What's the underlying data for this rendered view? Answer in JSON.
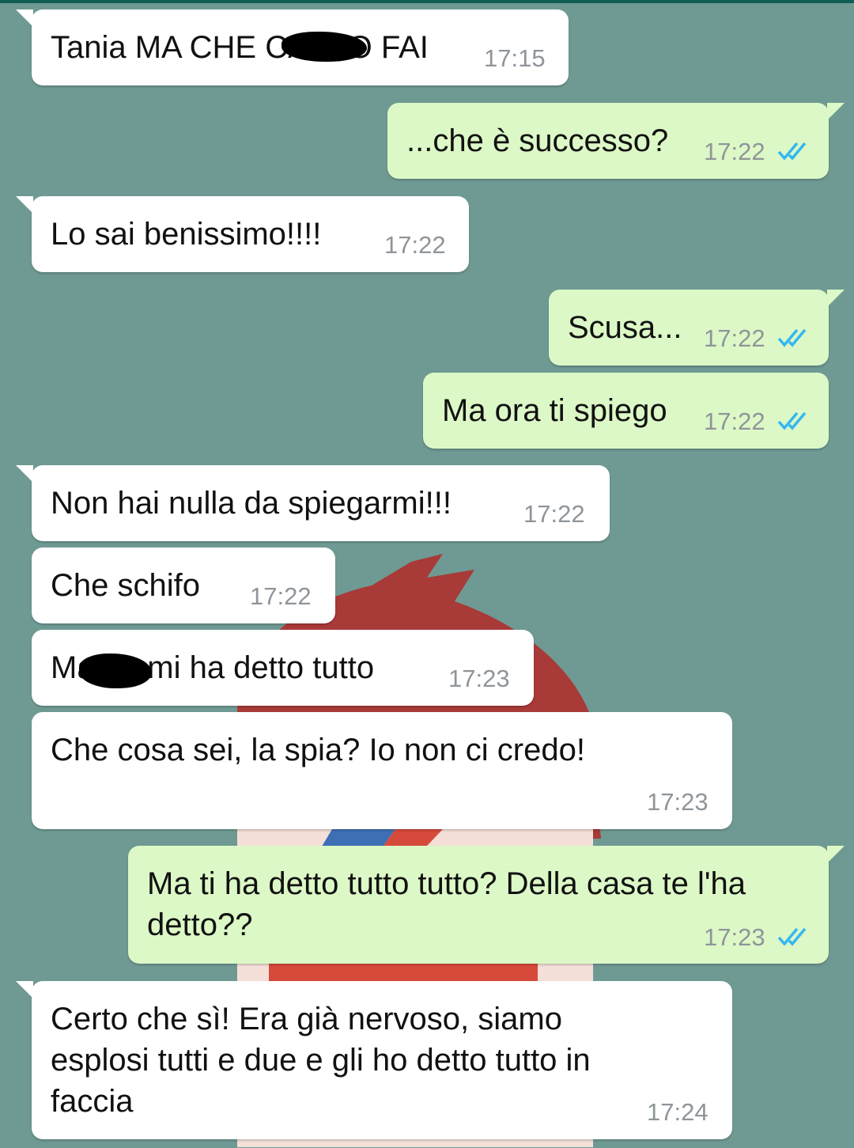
{
  "colors": {
    "background": "#6f9a93",
    "incoming_bubble": "#ffffff",
    "outgoing_bubble": "#dcf8c6",
    "read_ticks": "#34b7f1",
    "timestamp": "#8f959a"
  },
  "messages": [
    {
      "direction": "incoming",
      "text": "Tania MA CHE CAZZO FAI",
      "time": "17:15"
    },
    {
      "direction": "outgoing",
      "text": "...che è successo?",
      "time": "17:22",
      "status": "read"
    },
    {
      "direction": "incoming",
      "text": "Lo sai benissimo!!!!",
      "time": "17:22"
    },
    {
      "direction": "outgoing",
      "text": "Scusa...",
      "time": "17:22",
      "status": "read"
    },
    {
      "direction": "outgoing",
      "text": "Ma ora ti spiego",
      "time": "17:22",
      "status": "read"
    },
    {
      "direction": "incoming",
      "text": "Non hai nulla da spiegarmi!!!",
      "time": "17:22"
    },
    {
      "direction": "incoming",
      "text": "Che schifo",
      "time": "17:22"
    },
    {
      "direction": "incoming",
      "text": "Ma      mi ha detto tutto",
      "time": "17:23"
    },
    {
      "direction": "incoming",
      "text": "Che cosa sei, la spia? Io non ci credo!",
      "time": "17:23"
    },
    {
      "direction": "outgoing",
      "text": "Ma ti ha detto tutto tutto? Della casa te l'ha\ndetto??",
      "time": "17:23",
      "status": "read"
    },
    {
      "direction": "incoming",
      "text": "Certo che sì! Era già nervoso, siamo\nesplosi tutti e due e gli ho detto tutto in\nfaccia",
      "time": "17:24"
    }
  ]
}
